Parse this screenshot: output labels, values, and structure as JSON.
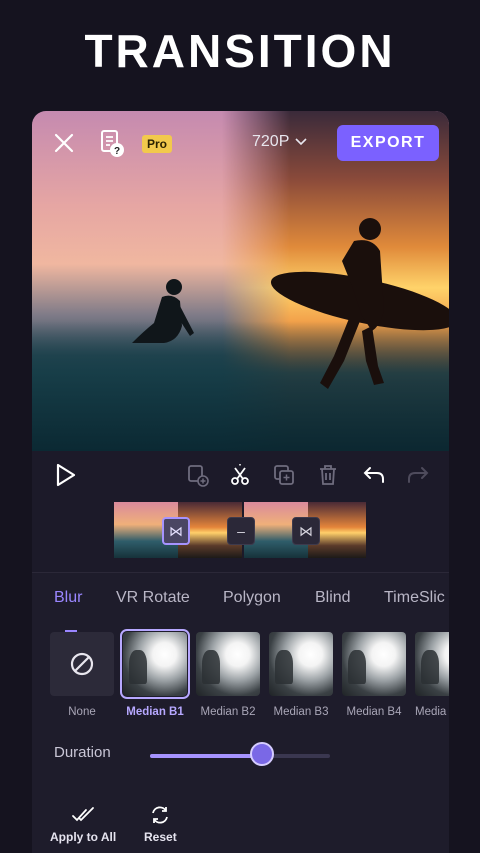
{
  "headline": "TRANSITION",
  "top_bar": {
    "pro_badge": "Pro",
    "resolution": "720P",
    "export_label": "EXPORT"
  },
  "timeline": {
    "transition_markers": [
      "⋈",
      "–",
      "⋈"
    ]
  },
  "transition_tabs": [
    {
      "label": "Blur",
      "active": true
    },
    {
      "label": "VR Rotate"
    },
    {
      "label": "Polygon"
    },
    {
      "label": "Blind"
    },
    {
      "label": "TimeSlic"
    }
  ],
  "presets": [
    {
      "label": "None"
    },
    {
      "label": "Median B1",
      "selected": true
    },
    {
      "label": "Median B2"
    },
    {
      "label": "Median B3"
    },
    {
      "label": "Median B4"
    },
    {
      "label": "Media"
    }
  ],
  "duration": {
    "label": "Duration",
    "value_fraction": 0.62
  },
  "actions": {
    "apply_all": "Apply to All",
    "reset": "Reset"
  },
  "colors": {
    "accent": "#7b61ff",
    "accent_light": "#a693ff",
    "pro": "#f2c94c",
    "background": "#15131f"
  },
  "icons": [
    "close-icon",
    "help-document-icon",
    "chevron-down-icon",
    "play-icon",
    "add-clip-icon",
    "split-scissors-icon",
    "duplicate-icon",
    "delete-icon",
    "undo-icon",
    "redo-icon",
    "none-icon",
    "double-check-icon",
    "reset-icon"
  ]
}
